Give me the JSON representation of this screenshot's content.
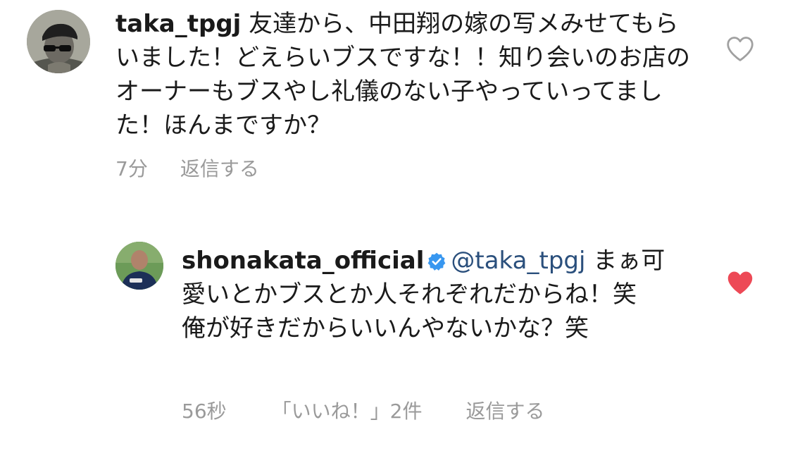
{
  "comments": [
    {
      "username": "taka_tpgj",
      "text": "友達から、中田翔の嫁の写メみせてもらいました！どえらいブスですな！！知り会いのお店のオーナーもブスやし礼儀のない子やっていってました！ほんまですか？",
      "time": "7分",
      "reply_label": "返信する",
      "liked": false,
      "avatar_icon": "person-sunglasses-avatar"
    },
    {
      "username": "shonakata_official",
      "verified": true,
      "mention": "@taka_tpgj",
      "text_line1": "まぁ可愛いとかブスとか人それぞれだからね！笑",
      "text_line2": "俺が好きだからいいんやないかな？笑",
      "time": "56秒",
      "likes_label": "「いいね！」2件",
      "reply_label": "返信する",
      "liked": true,
      "avatar_icon": "person-avatar"
    }
  ],
  "colors": {
    "text": "#1a1a1a",
    "muted": "#9a9a9a",
    "mention": "#2a4f7c",
    "verified": "#3897f0",
    "heart_liked": "#ed4956",
    "heart_outline": "#a0a0a0"
  }
}
